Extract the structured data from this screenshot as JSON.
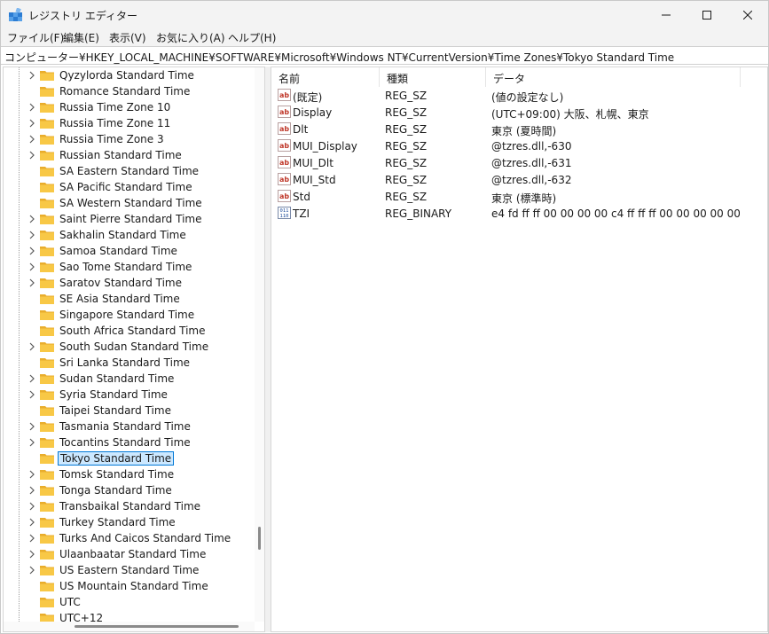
{
  "window": {
    "title": "レジストリ エディター"
  },
  "menu": [
    "ファイル(F)",
    "編集(E)",
    "表示(V)",
    "お気に入り(A)",
    "ヘルプ(H)"
  ],
  "address": "コンピューター¥HKEY_LOCAL_MACHINE¥SOFTWARE¥Microsoft¥Windows NT¥CurrentVersion¥Time Zones¥Tokyo Standard Time",
  "tree": {
    "items": [
      {
        "label": "Qyzylorda Standard Time",
        "expandable": true
      },
      {
        "label": "Romance Standard Time",
        "expandable": false
      },
      {
        "label": "Russia Time Zone 10",
        "expandable": true
      },
      {
        "label": "Russia Time Zone 11",
        "expandable": true
      },
      {
        "label": "Russia Time Zone 3",
        "expandable": true
      },
      {
        "label": "Russian Standard Time",
        "expandable": true
      },
      {
        "label": "SA Eastern Standard Time",
        "expandable": false
      },
      {
        "label": "SA Pacific Standard Time",
        "expandable": false
      },
      {
        "label": "SA Western Standard Time",
        "expandable": false
      },
      {
        "label": "Saint Pierre Standard Time",
        "expandable": true
      },
      {
        "label": "Sakhalin Standard Time",
        "expandable": true
      },
      {
        "label": "Samoa Standard Time",
        "expandable": true
      },
      {
        "label": "Sao Tome Standard Time",
        "expandable": true
      },
      {
        "label": "Saratov Standard Time",
        "expandable": true
      },
      {
        "label": "SE Asia Standard Time",
        "expandable": false
      },
      {
        "label": "Singapore Standard Time",
        "expandable": false
      },
      {
        "label": "South Africa Standard Time",
        "expandable": false
      },
      {
        "label": "South Sudan Standard Time",
        "expandable": true
      },
      {
        "label": "Sri Lanka Standard Time",
        "expandable": false
      },
      {
        "label": "Sudan Standard Time",
        "expandable": true
      },
      {
        "label": "Syria Standard Time",
        "expandable": true
      },
      {
        "label": "Taipei Standard Time",
        "expandable": false
      },
      {
        "label": "Tasmania Standard Time",
        "expandable": true
      },
      {
        "label": "Tocantins Standard Time",
        "expandable": true
      },
      {
        "label": "Tokyo Standard Time",
        "expandable": false,
        "selected": true
      },
      {
        "label": "Tomsk Standard Time",
        "expandable": true
      },
      {
        "label": "Tonga Standard Time",
        "expandable": true
      },
      {
        "label": "Transbaikal Standard Time",
        "expandable": true
      },
      {
        "label": "Turkey Standard Time",
        "expandable": true
      },
      {
        "label": "Turks And Caicos Standard Time",
        "expandable": true
      },
      {
        "label": "Ulaanbaatar Standard Time",
        "expandable": true
      },
      {
        "label": "US Eastern Standard Time",
        "expandable": true
      },
      {
        "label": "US Mountain Standard Time",
        "expandable": false
      },
      {
        "label": "UTC",
        "expandable": false
      },
      {
        "label": "UTC+12",
        "expandable": false
      }
    ]
  },
  "values": {
    "columns": {
      "name": "名前",
      "type": "種類",
      "data": "データ"
    },
    "rows": [
      {
        "icon": "string-value-icon",
        "name": "(既定)",
        "type": "REG_SZ",
        "data": "(値の設定なし)"
      },
      {
        "icon": "string-value-icon",
        "name": "Display",
        "type": "REG_SZ",
        "data": "(UTC+09:00) 大阪、札幌、東京"
      },
      {
        "icon": "string-value-icon",
        "name": "Dlt",
        "type": "REG_SZ",
        "data": "東京 (夏時間)"
      },
      {
        "icon": "string-value-icon",
        "name": "MUI_Display",
        "type": "REG_SZ",
        "data": "@tzres.dll,-630"
      },
      {
        "icon": "string-value-icon",
        "name": "MUI_Dlt",
        "type": "REG_SZ",
        "data": "@tzres.dll,-631"
      },
      {
        "icon": "string-value-icon",
        "name": "MUI_Std",
        "type": "REG_SZ",
        "data": "@tzres.dll,-632"
      },
      {
        "icon": "string-value-icon",
        "name": "Std",
        "type": "REG_SZ",
        "data": "東京 (標準時)"
      },
      {
        "icon": "binary-value-icon",
        "name": "TZI",
        "type": "REG_BINARY",
        "data": "e4 fd ff ff 00 00 00 00 c4 ff ff ff 00 00 00 00 00 00 00 0..."
      }
    ]
  },
  "colors": {
    "selection_bg": "#cce8ff",
    "selection_border": "#0078d7",
    "folder": "#f8c846",
    "string_icon": "#c0392b",
    "binary_icon": "#1f4e9c"
  }
}
